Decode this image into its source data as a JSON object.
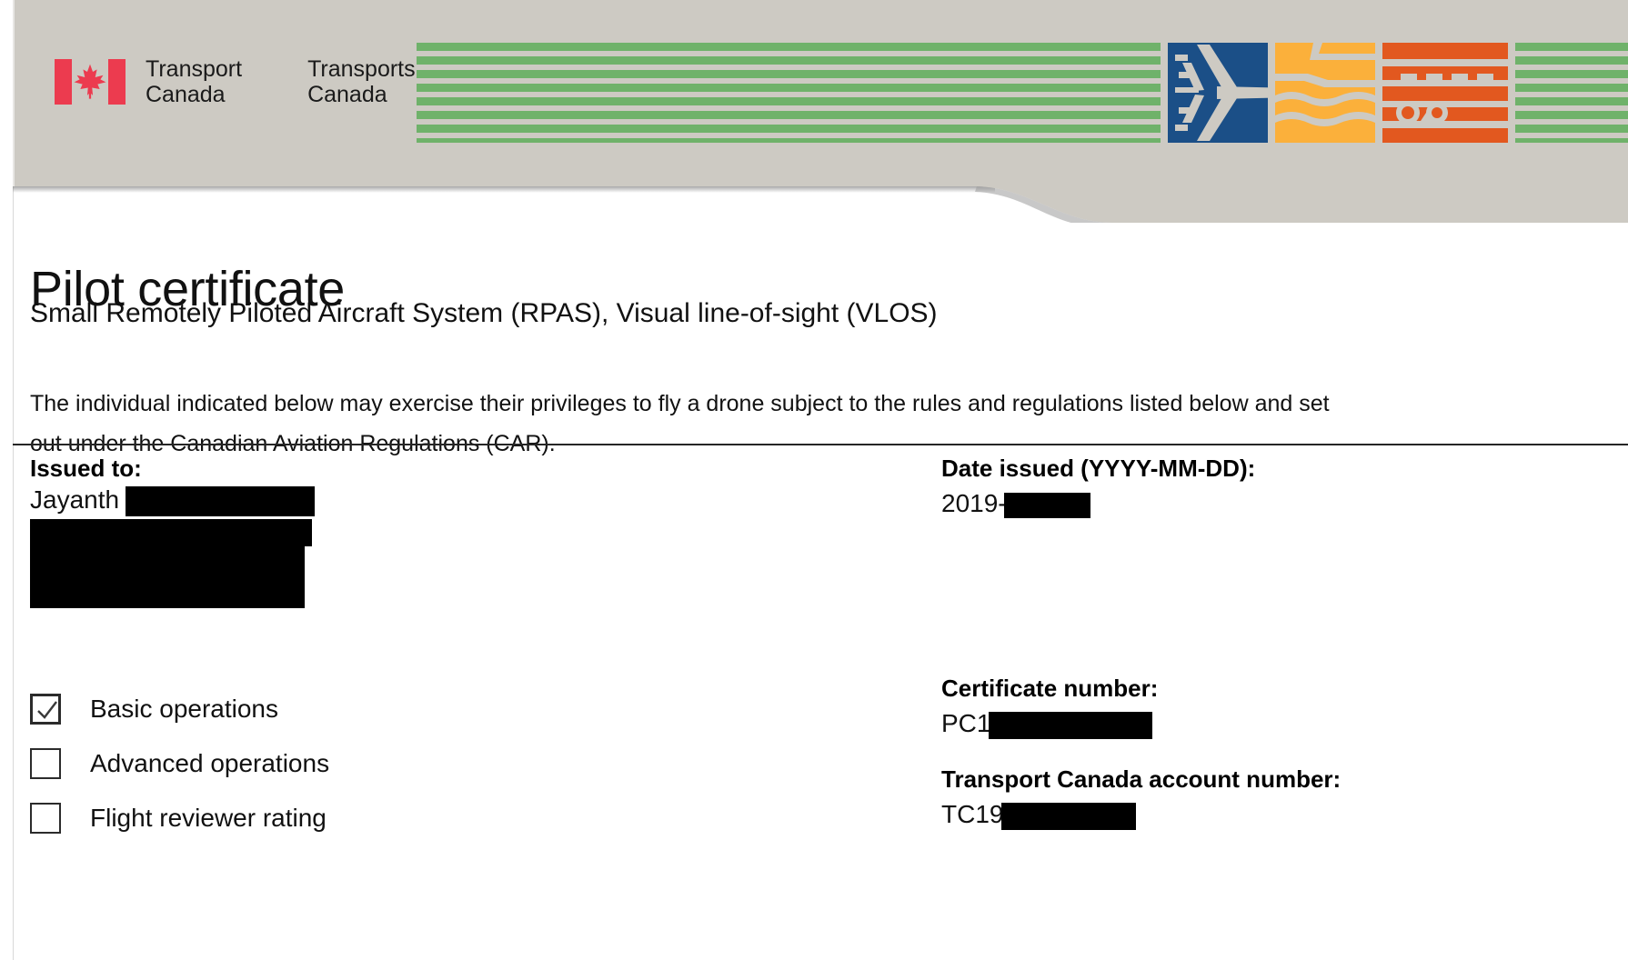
{
  "header": {
    "flag_icon": "canada-flag-icon",
    "wordmark_en": "Transport\nCanada",
    "wordmark_fr": "Transports\nCanada",
    "mosaic_icons": [
      "airplane-icon",
      "ship-waves-icon",
      "railcar-icon"
    ],
    "colors": {
      "band": "#cdcac3",
      "flag_red": "#ec3b4f",
      "green": "#6fb26a",
      "blue": "#1b4f87",
      "orange": "#fbb03b",
      "red_orange": "#e2581f"
    }
  },
  "document": {
    "title": "Pilot certificate",
    "subtitle": "Small Remotely Piloted Aircraft System (RPAS), Visual line-of-sight (VLOS)",
    "intro": "The individual indicated below may exercise their privileges to fly a drone subject to the rules and regulations listed below and set out under the Canadian Aviation Regulations (CAR)."
  },
  "issued_to": {
    "label": "Issued to:",
    "name": "Jayanth",
    "name_redacted": true,
    "address_redacted": true
  },
  "date_issued": {
    "label": "Date issued (YYYY-MM-DD):",
    "value_prefix": "2019-",
    "value_redacted": true
  },
  "certificate_number": {
    "label": "Certificate number:",
    "value_prefix": "PC1",
    "value_redacted": true
  },
  "account_number": {
    "label": "Transport Canada account number:",
    "value_prefix": "TC19",
    "value_redacted": true
  },
  "operations": [
    {
      "label": "Basic operations",
      "checked": true
    },
    {
      "label": "Advanced operations",
      "checked": false
    },
    {
      "label": "Flight reviewer rating",
      "checked": false
    }
  ]
}
